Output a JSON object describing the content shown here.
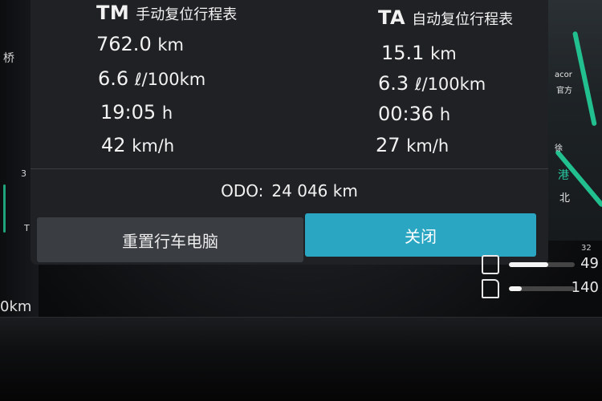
{
  "trip": {
    "tm": {
      "abbr": "TM",
      "name": "手动复位行程表",
      "distance": "762.0",
      "distance_unit": "km",
      "consumption": "6.6",
      "consumption_unit": "ℓ/100km",
      "time": "19:05",
      "time_unit": "h",
      "speed": "42",
      "speed_unit": "km/h"
    },
    "ta": {
      "abbr": "TA",
      "name": "自动复位行程表",
      "distance": "15.1",
      "distance_unit": "km",
      "consumption": "6.3",
      "consumption_unit": "ℓ/100km",
      "time": "00:36",
      "time_unit": "h",
      "speed": "27",
      "speed_unit": "km/h"
    },
    "odo": {
      "label": "ODO:",
      "value": "24 046",
      "unit": "km"
    },
    "buttons": {
      "reset": "重置行车电脑",
      "close": "关闭"
    }
  },
  "cluster": {
    "left_texts": [
      "桥",
      "3",
      "T",
      "0km"
    ],
    "map_texts": [
      "acor",
      "官方",
      "徐",
      "港",
      "北"
    ],
    "gauges": [
      {
        "icon": "oil-temp-icon",
        "value": "49",
        "fill": 0.6
      },
      {
        "icon": "fuel-icon",
        "value": "140",
        "fill": 0.2
      }
    ],
    "small_value": "32"
  },
  "colors": {
    "accent": "#2aa6c3",
    "panel": "#1f2124",
    "map_road": "#22c08f"
  }
}
